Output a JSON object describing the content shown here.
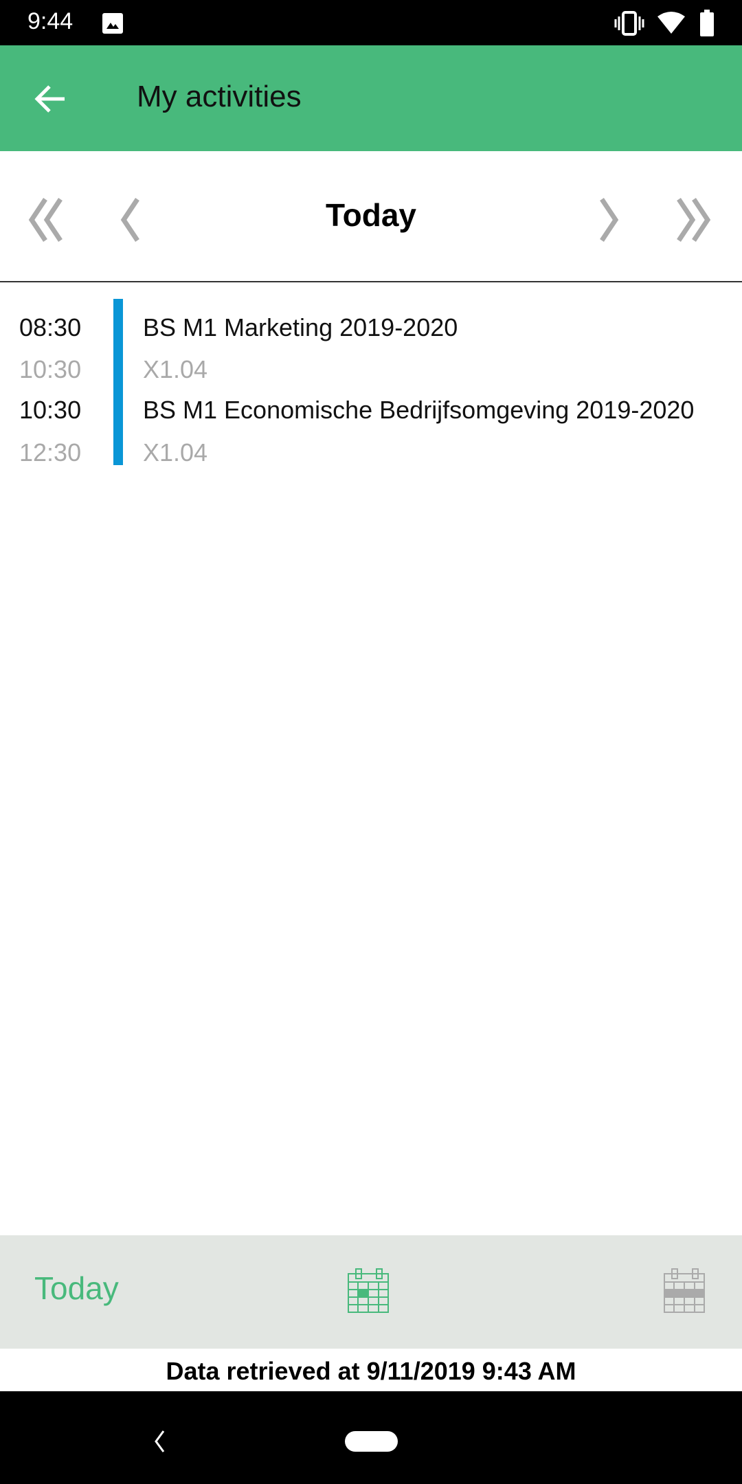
{
  "status_bar": {
    "time": "9:44",
    "icons": [
      "image-icon",
      "vibrate-icon",
      "wifi-icon",
      "battery-icon"
    ]
  },
  "app_bar": {
    "title": "My activities",
    "back_icon": "arrow-left-icon"
  },
  "date_nav": {
    "label": "Today",
    "icons": [
      "double-chevron-left-icon",
      "chevron-left-icon",
      "chevron-right-icon",
      "double-chevron-right-icon"
    ]
  },
  "activities": [
    {
      "start": "08:30",
      "end": "10:30",
      "title": "BS M1 Marketing 2019-2020",
      "location": "X1.04"
    },
    {
      "start": "10:30",
      "end": "12:30",
      "title": "BS M1 Economische Bedrijfsomgeving 2019-2020",
      "location": "X1.04"
    }
  ],
  "bottom_bar": {
    "today_label": "Today",
    "day_view_icon": "calendar-day-icon",
    "week_view_icon": "calendar-week-icon"
  },
  "footer": {
    "text": "Data retrieved at 9/11/2019 9:43 AM"
  },
  "colors": {
    "accent": "#48b97c",
    "event_bar": "#0a96d6",
    "bottom_bar": "#e2e6e2"
  }
}
